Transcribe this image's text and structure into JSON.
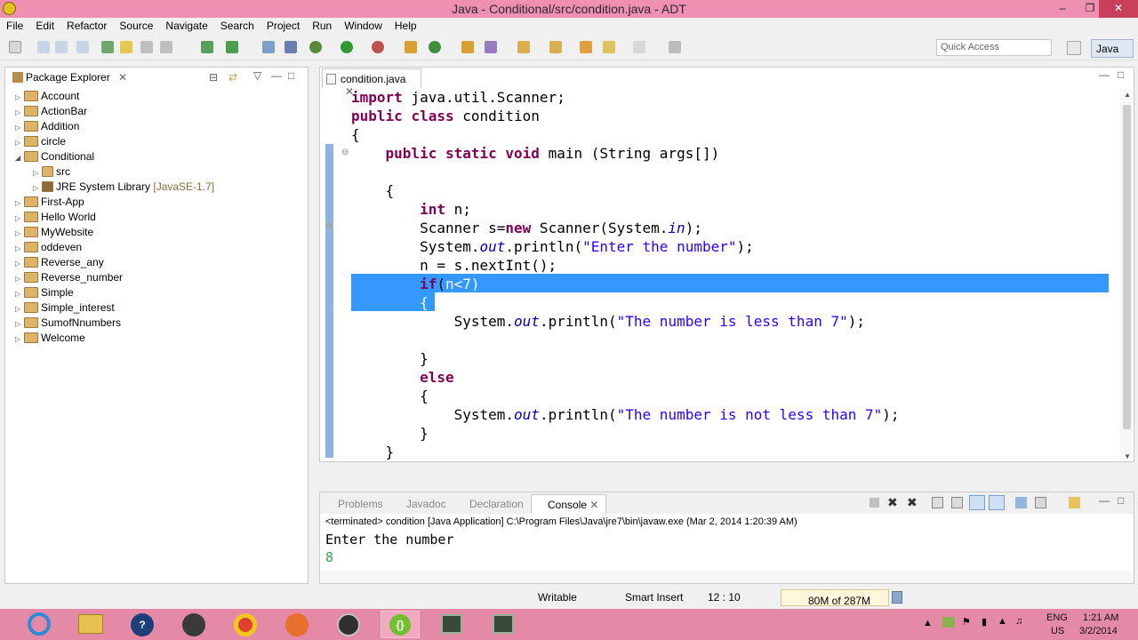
{
  "window": {
    "title": "Java - Conditional/src/condition.java - ADT"
  },
  "menu": [
    "File",
    "Edit",
    "Refactor",
    "Source",
    "Navigate",
    "Search",
    "Project",
    "Run",
    "Window",
    "Help"
  ],
  "toolbar": {
    "quick_access": "Quick Access",
    "perspective": "Java"
  },
  "package_explorer": {
    "title": "Package Explorer",
    "items": [
      "Account",
      "ActionBar",
      "Addition",
      "circle",
      "Conditional",
      "src",
      "JRE System Library",
      "First-App",
      "Hello World",
      "MyWebsite",
      "oddeven",
      "Reverse_any",
      "Reverse_number",
      "Simple",
      "Simple_interest",
      "SumofNnumbers",
      "Welcome"
    ],
    "jre_suffix": "[JavaSE-1.7]"
  },
  "editor": {
    "tab": "condition.java",
    "lines": [
      "import java.util.Scanner;",
      "public class condition",
      "{",
      "    public static void main (String args[])",
      "",
      "    {",
      "        int n;",
      "        Scanner s=new Scanner(System.in);",
      "        System.out.println(\"Enter the number\");",
      "        n = s.nextInt();",
      "        if(n<7)",
      "        {",
      "            System.out.println(\"The number is less than 7\");",
      "",
      "        }",
      "        else",
      "        {",
      "            System.out.println(\"The number is not less than 7\");",
      "        }",
      "    }"
    ]
  },
  "console": {
    "tabs": [
      "Problems",
      "Javadoc",
      "Declaration",
      "Console"
    ],
    "header": "<terminated> condition [Java Application] C:\\Program Files\\Java\\jre7\\bin\\javaw.exe (Mar 2, 2014 1:20:39 AM)",
    "output_line": "Enter the number",
    "input_line": "8"
  },
  "status": {
    "writable": "Writable",
    "insert": "Smart Insert",
    "position": "12 : 10",
    "memory": "80M of 287M"
  },
  "tray": {
    "lang": "ENG",
    "region": "US",
    "time": "1:21 AM",
    "date": "3/2/2014"
  },
  "colors": {
    "titlebar": "#ef8fb2",
    "taskbar": "#e58aa6",
    "keyword": "#7f0055",
    "string": "#2a00ff",
    "selection": "#3399ff"
  }
}
